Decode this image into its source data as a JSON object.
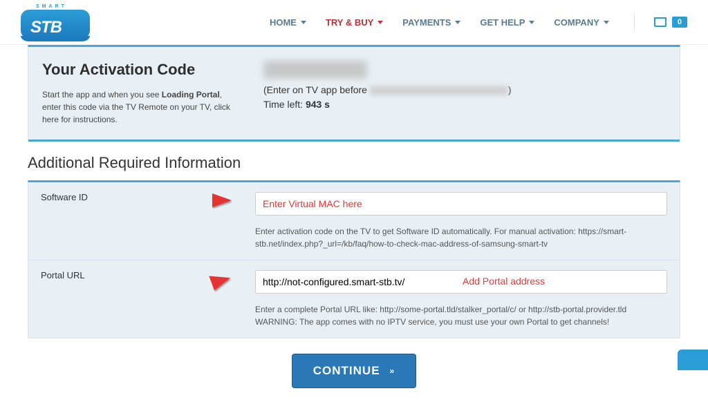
{
  "logo": {
    "small": "SMART",
    "big": "STB"
  },
  "nav": {
    "home": "HOME",
    "try_buy": "TRY & BUY",
    "payments": "PAYMENTS",
    "get_help": "GET HELP",
    "company": "COMPANY",
    "cart_count": "0"
  },
  "activation": {
    "title": "Your Activation Code",
    "desc_pre": "Start the app and when you see ",
    "desc_bold": "Loading Portal",
    "desc_post": ", enter this code via the TV Remote on your TV, click here for instructions.",
    "enter_before": "(Enter on TV app before ",
    "enter_close": ")",
    "time_left_label": "Time left: ",
    "time_left_value": "943 s"
  },
  "section": "Additional Required Information",
  "software": {
    "label": "Software ID",
    "placeholder": "Enter Virtual MAC here",
    "help": "Enter activation code on the TV to get Software ID automatically. For manual activation: https://smart-stb.net/index.php?_url=/kb/faq/how-to-check-mac-address-of-samsung-smart-tv"
  },
  "portal": {
    "label": "Portal URL",
    "value": "http://not-configured.smart-stb.tv/",
    "annotation": "Add Portal address",
    "help": "Enter a complete Portal URL like: http://some-portal.tld/stalker_portal/c/ or http://stb-portal.provider.tld WARNING: The app comes with no IPTV service, you must use your own Portal to get channels!"
  },
  "continue": "CONTINUE"
}
